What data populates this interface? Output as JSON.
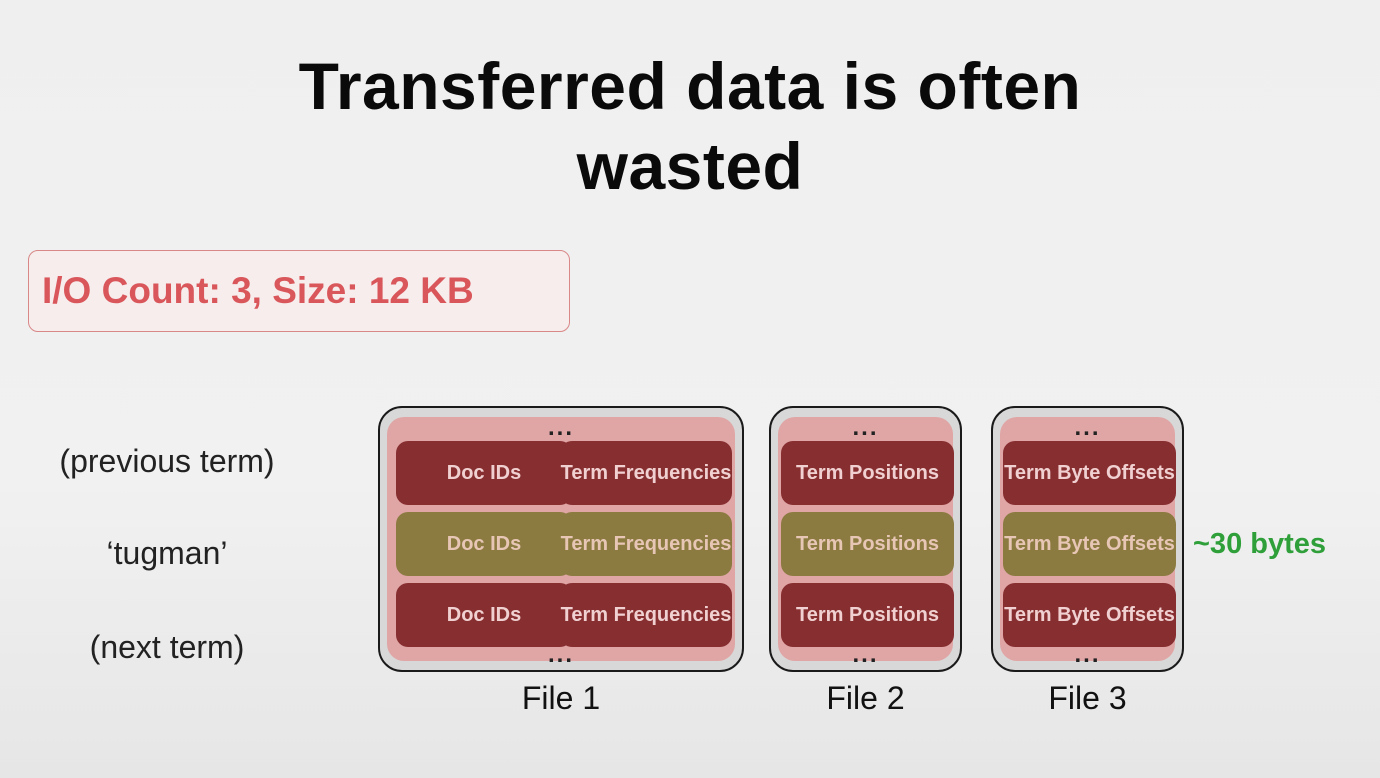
{
  "title": {
    "line1": "Transferred data is often",
    "line2": "wasted"
  },
  "io_summary": "I/O Count: 3, Size: 12 KB",
  "row_labels": [
    "(previous term)",
    "‘tugman’",
    "(next term)"
  ],
  "ellipsis": "...",
  "files": [
    {
      "label": "File 1",
      "rows": [
        {
          "cells": [
            "Doc IDs",
            "Term Frequencies"
          ]
        },
        {
          "cells": [
            "Doc IDs",
            "Term Frequencies"
          ]
        },
        {
          "cells": [
            "Doc IDs",
            "Term Frequencies"
          ]
        }
      ]
    },
    {
      "label": "File 2",
      "rows": [
        {
          "cells": [
            "Term Positions"
          ]
        },
        {
          "cells": [
            "Term Positions"
          ]
        },
        {
          "cells": [
            "Term Positions"
          ]
        }
      ]
    },
    {
      "label": "File 3",
      "rows": [
        {
          "cells": [
            "Term Byte Offsets"
          ]
        },
        {
          "cells": [
            "Term Byte Offsets"
          ]
        },
        {
          "cells": [
            "Term Byte Offsets"
          ]
        }
      ]
    }
  ],
  "highlight_row_index": 1,
  "size_note": "~30 bytes",
  "colors": {
    "title": "#0a0a0a",
    "io_summary_text": "#d9575b",
    "io_summary_border": "#d98787",
    "file_band": "#e0a6a6",
    "cell_dark": "#872e30",
    "cell_highlight": "#8b7b41",
    "size_note": "#2f9f3a"
  }
}
